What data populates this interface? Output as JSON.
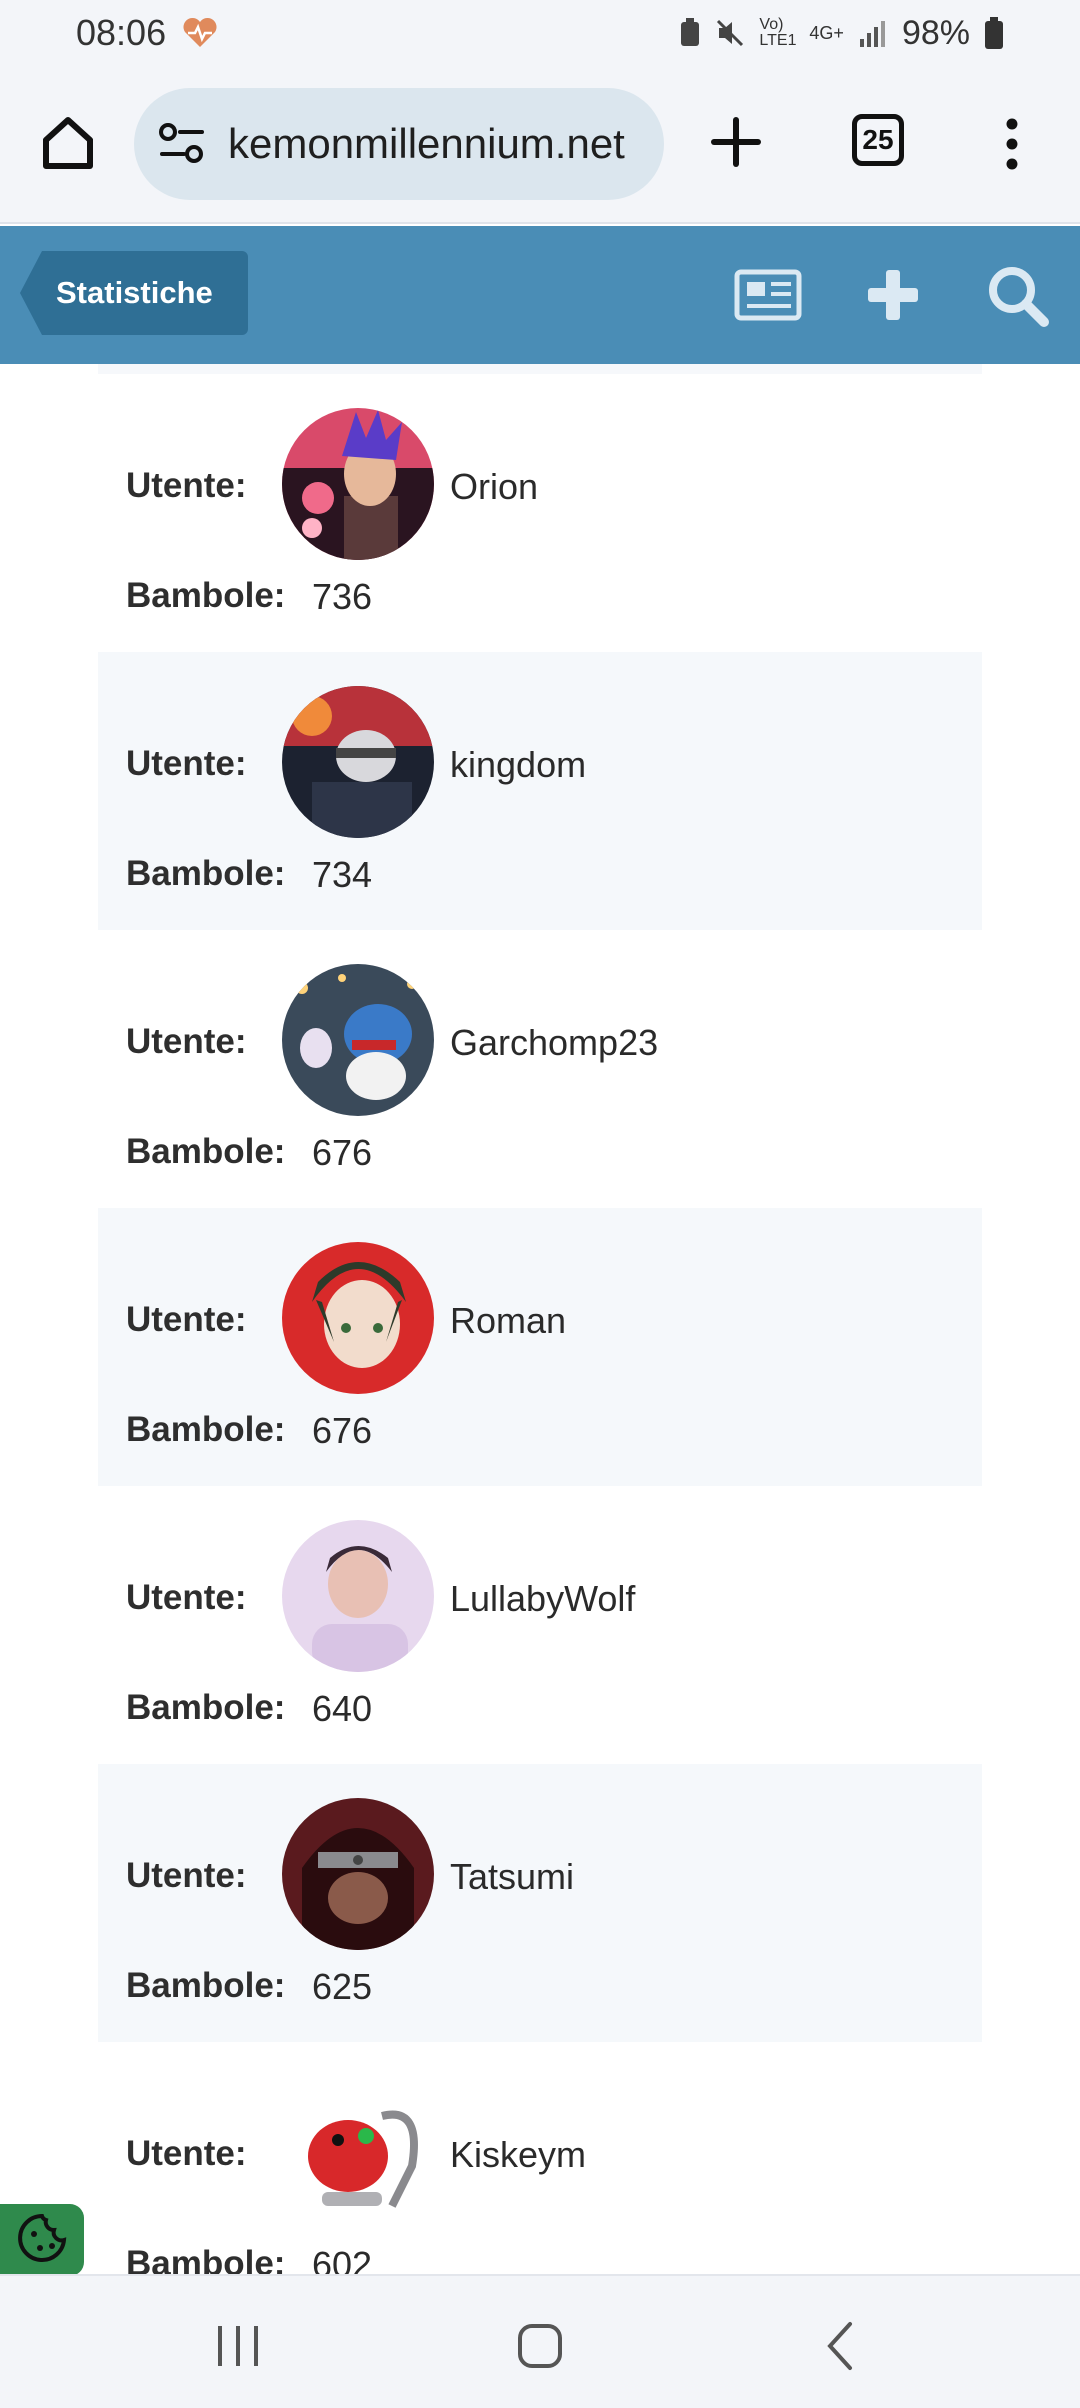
{
  "status_bar": {
    "time": "08:06",
    "network": "Vo) LTE1",
    "network_type": "4G+",
    "battery": "98%"
  },
  "browser": {
    "url": "kemonmillennium.net",
    "tab_count": "25"
  },
  "header": {
    "back_label": "Statistiche",
    "accent_color": "#4a8db6",
    "back_color": "#2f6f95"
  },
  "list": {
    "user_label": "Utente:",
    "dolls_label": "Bambole:",
    "entries": [
      {
        "name": "Orion",
        "dolls": "736"
      },
      {
        "name": "kingdom",
        "dolls": "734"
      },
      {
        "name": "Garchomp23",
        "dolls": "676"
      },
      {
        "name": "Roman",
        "dolls": "676"
      },
      {
        "name": "LullabyWolf",
        "dolls": "640"
      },
      {
        "name": "Tatsumi",
        "dolls": "625"
      },
      {
        "name": "Kiskeym",
        "dolls": "602"
      }
    ]
  },
  "cookie_color": "#2f8a4c"
}
